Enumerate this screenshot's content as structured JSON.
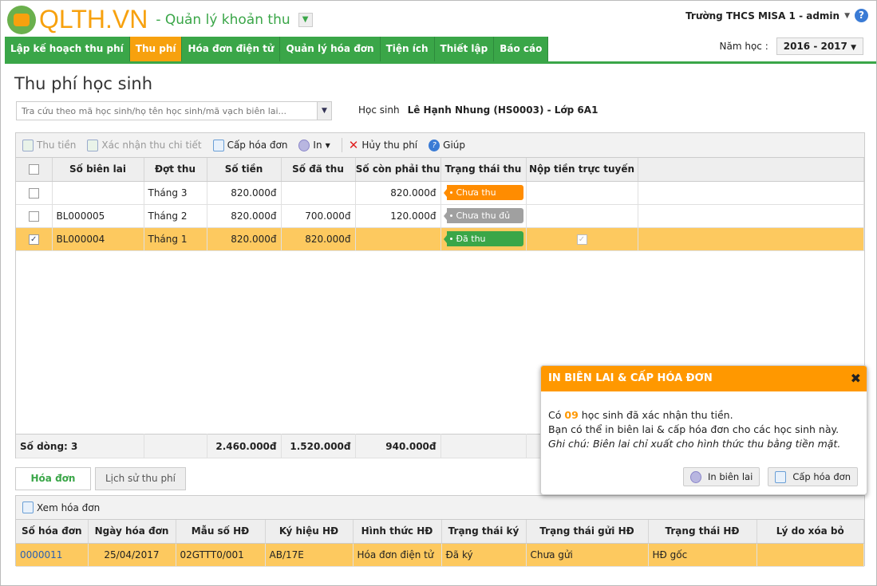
{
  "app": {
    "logo": "QLTH.VN",
    "subtitle": "- Quản lý khoản thu",
    "user": "Trường THCS MISA 1 - admin"
  },
  "nav": [
    "Lập kế hoạch thu phí",
    "Thu phí",
    "Hóa đơn điện tử",
    "Quản lý hóa đơn",
    "Tiện ích",
    "Thiết lập",
    "Báo cáo"
  ],
  "year": {
    "label": "Năm học :",
    "value": "2016 - 2017"
  },
  "page_title": "Thu phí học sinh",
  "search": {
    "placeholder": "Tra cứu theo mã học sinh/họ tên học sinh/mã vạch biên lai..."
  },
  "student": {
    "label": "Học sinh",
    "value": "Lê Hạnh Nhung (HS0003) - Lớp 6A1"
  },
  "toolbar": {
    "thu_tien": "Thu tiền",
    "xac_nhan": "Xác nhận thu chi tiết",
    "cap_hoa_don": "Cấp hóa đơn",
    "in": "In",
    "huy": "Hủy thu phí",
    "giup": "Giúp"
  },
  "fee_table": {
    "headers": [
      "Số biên lai",
      "Đợt thu",
      "Số tiền",
      "Số đã thu",
      "Số còn phải thu",
      "Trạng thái thu",
      "Nộp tiền trực tuyến"
    ],
    "rows": [
      {
        "checked": false,
        "receipt": "",
        "period": "Tháng 3",
        "amount": "820.000đ",
        "paid": "",
        "remaining": "820.000đ",
        "status": "Chưa thu",
        "status_color": "#ff8c00",
        "online": false
      },
      {
        "checked": false,
        "receipt": "BL000005",
        "period": "Tháng 2",
        "amount": "820.000đ",
        "paid": "700.000đ",
        "remaining": "120.000đ",
        "status": "Chưa thu đủ",
        "status_color": "#a0a0a0",
        "online": false
      },
      {
        "checked": true,
        "receipt": "BL000004",
        "period": "Tháng 1",
        "amount": "820.000đ",
        "paid": "820.000đ",
        "remaining": "",
        "status": "Đã thu",
        "status_color": "#3aa648",
        "online": true
      }
    ],
    "footer": {
      "count": "Số dòng: 3",
      "amount": "2.460.000đ",
      "paid": "1.520.000đ",
      "remaining": "940.000đ"
    }
  },
  "tabs": [
    "Hóa đơn",
    "Lịch sử thu phí"
  ],
  "invoice_toolbar": {
    "view": "Xem hóa đơn"
  },
  "invoice_table": {
    "headers": [
      "Số hóa đơn",
      "Ngày hóa đơn",
      "Mẫu số HĐ",
      "Ký hiệu HĐ",
      "Hình thức HĐ",
      "Trạng thái ký",
      "Trạng thái gửi HĐ",
      "Trạng thái HĐ",
      "Lý do xóa bỏ"
    ],
    "rows": [
      [
        "0000011",
        "25/04/2017",
        "02GTTT0/001",
        "AB/17E",
        "Hóa đơn điện tử",
        "Đã ký",
        "Chưa gửi",
        "HĐ gốc",
        ""
      ]
    ]
  },
  "popup": {
    "title": "IN BIÊN LAI & CẤP HÓA ĐƠN",
    "line1_pre": "Có",
    "count": "09",
    "line1_post": "học sinh đã xác nhận thu tiền.",
    "line2": "Bạn có thể in biên lai & cấp hóa đơn cho các học sinh này.",
    "note": "Ghi chú: Biên lai chỉ xuất cho hình thức thu bằng tiền mặt.",
    "btn_print": "In biên lai",
    "btn_invoice": "Cấp hóa đơn"
  }
}
